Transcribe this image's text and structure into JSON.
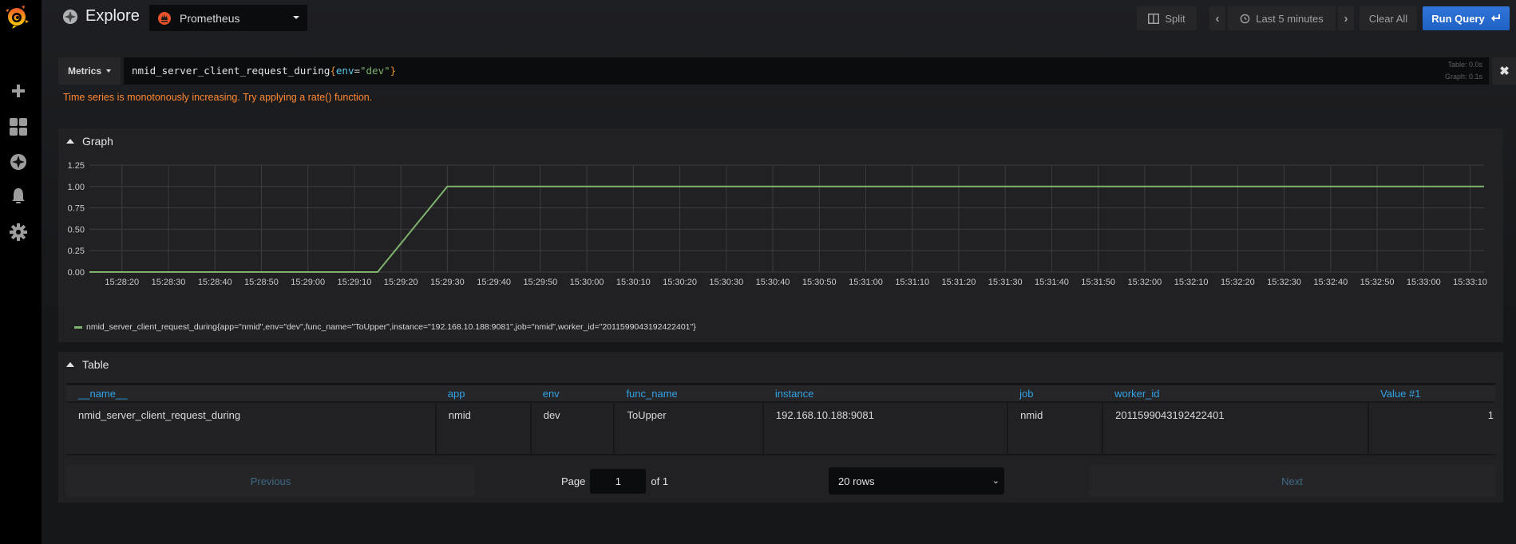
{
  "sidebar": {
    "logo": "grafana-logo",
    "items": [
      {
        "name": "create",
        "icon": "plus-icon"
      },
      {
        "name": "dashboards",
        "icon": "dashboard-grid-icon"
      },
      {
        "name": "explore",
        "icon": "compass-icon"
      },
      {
        "name": "alerting",
        "icon": "bell-icon"
      },
      {
        "name": "configuration",
        "icon": "gear-icon"
      }
    ]
  },
  "header": {
    "title": "Explore",
    "datasource": "Prometheus",
    "split_label": "Split",
    "time_range": "Last 5 minutes",
    "clear_all_label": "Clear All",
    "run_query_label": "Run Query"
  },
  "query": {
    "metrics_label": "Metrics",
    "metric_name": "nmid_server_client_request_during",
    "brace_open": "{",
    "label_key": "env",
    "operator": "=",
    "label_value": "\"dev\"",
    "brace_close": "}",
    "timing_table": "Table: 0.0s",
    "timing_graph": "Graph: 0.1s",
    "hint": "Time series is monotonously increasing. Try applying a rate() function."
  },
  "graph_panel": {
    "title": "Graph",
    "legend": "nmid_server_client_request_during{app=\"nmid\",env=\"dev\",func_name=\"ToUpper\",instance=\"192.168.10.188:9081\",job=\"nmid\",worker_id=\"2011599043192422401\"}"
  },
  "chart_data": {
    "type": "line",
    "title": "Graph",
    "xlabel": "",
    "ylabel": "",
    "x_range": [
      "15:28:13",
      "15:33:13"
    ],
    "ylim": [
      0,
      1.25
    ],
    "y_ticks": [
      "0.00",
      "0.25",
      "0.50",
      "0.75",
      "1.00",
      "1.25"
    ],
    "x_ticks": [
      "15:28:20",
      "15:28:30",
      "15:28:40",
      "15:28:50",
      "15:29:00",
      "15:29:10",
      "15:29:20",
      "15:29:30",
      "15:29:40",
      "15:29:50",
      "15:30:00",
      "15:30:10",
      "15:30:20",
      "15:30:30",
      "15:30:40",
      "15:30:50",
      "15:31:00",
      "15:31:10",
      "15:31:20",
      "15:31:30",
      "15:31:40",
      "15:31:50",
      "15:32:00",
      "15:32:10",
      "15:32:20",
      "15:32:30",
      "15:32:40",
      "15:32:50",
      "15:33:00",
      "15:33:10"
    ],
    "grid": true,
    "legend_position": "bottom-left",
    "series": [
      {
        "name": "nmid_server_client_request_during{app=\"nmid\",env=\"dev\",func_name=\"ToUpper\",instance=\"192.168.10.188:9081\",job=\"nmid\",worker_id=\"2011599043192422401\"}",
        "color": "#7eb26d",
        "x": [
          "15:28:13",
          "15:29:15",
          "15:29:30",
          "15:33:13"
        ],
        "values": [
          0,
          0,
          1,
          1
        ]
      }
    ]
  },
  "table_panel": {
    "title": "Table",
    "columns": [
      "__name__",
      "app",
      "env",
      "func_name",
      "instance",
      "job",
      "worker_id",
      "Value #1"
    ],
    "rows": [
      [
        "nmid_server_client_request_during",
        "nmid",
        "dev",
        "ToUpper",
        "192.168.10.188:9081",
        "nmid",
        "2011599043192422401",
        "1"
      ]
    ],
    "pagination": {
      "previous_label": "Previous",
      "page_label": "Page",
      "page_value": "1",
      "of_label": "of 1",
      "rows_option": "20 rows",
      "next_label": "Next"
    }
  },
  "colors": {
    "accent": "#3274d9",
    "series": "#7eb26d",
    "warning": "#ff8833",
    "table_header": "#33a2e5"
  }
}
